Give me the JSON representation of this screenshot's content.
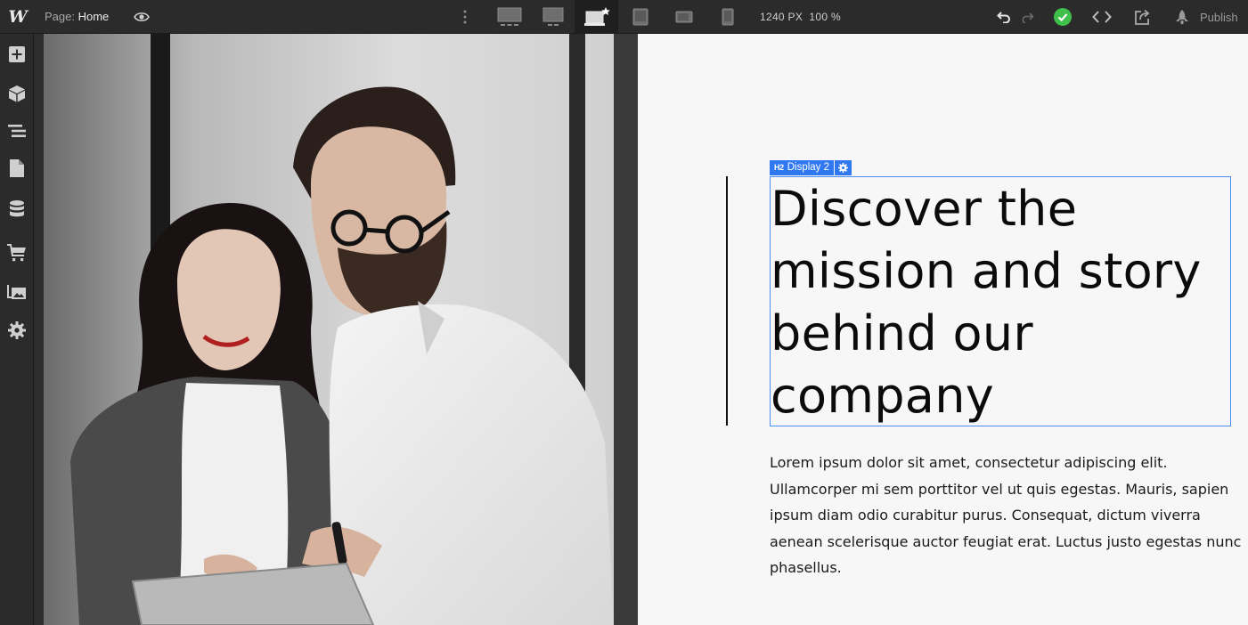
{
  "app": {
    "logo": "W"
  },
  "toolbar": {
    "page_prefix": "Page:",
    "page_name": "Home",
    "canvas_width": "1240 PX",
    "zoom": "100 %",
    "publish_label": "Publish",
    "breakpoints": [
      {
        "name": "breakpoint-1920",
        "icon": "desktop-large-icon"
      },
      {
        "name": "breakpoint-1440",
        "icon": "desktop-icon"
      },
      {
        "name": "breakpoint-base",
        "icon": "desktop-base-icon",
        "active": true
      },
      {
        "name": "breakpoint-tablet",
        "icon": "tablet-icon"
      },
      {
        "name": "breakpoint-mobile-landscape",
        "icon": "mobile-landscape-icon"
      },
      {
        "name": "breakpoint-mobile-portrait",
        "icon": "mobile-portrait-icon"
      }
    ],
    "status_color": "#3fc04a"
  },
  "sidebar": {
    "items": [
      {
        "name": "add-panel",
        "icon": "plus-icon"
      },
      {
        "name": "symbols-panel",
        "icon": "cube-icon"
      },
      {
        "name": "navigator-panel",
        "icon": "navigator-icon"
      },
      {
        "name": "pages-panel",
        "icon": "page-icon"
      },
      {
        "name": "cms-panel",
        "icon": "database-icon"
      },
      {
        "name": "ecommerce-panel",
        "icon": "cart-icon"
      },
      {
        "name": "assets-panel",
        "icon": "images-icon"
      },
      {
        "name": "settings-panel",
        "icon": "gear-icon"
      }
    ]
  },
  "canvas": {
    "selection_tag": {
      "type": "H2",
      "label": "Display 2"
    },
    "accent": "#2f78f0",
    "heading": "Discover the mission and story behind our company",
    "paragraph": "Lorem ipsum dolor sit amet, consectetur adipiscing elit. Ullamcorper mi sem porttitor vel ut quis egestas. Mauris, sapien ipsum diam odio curabitur purus. Consequat, dictum viverra aenean scelerisque auctor feugiat erat. Luctus justo egestas nunc phasellus."
  }
}
